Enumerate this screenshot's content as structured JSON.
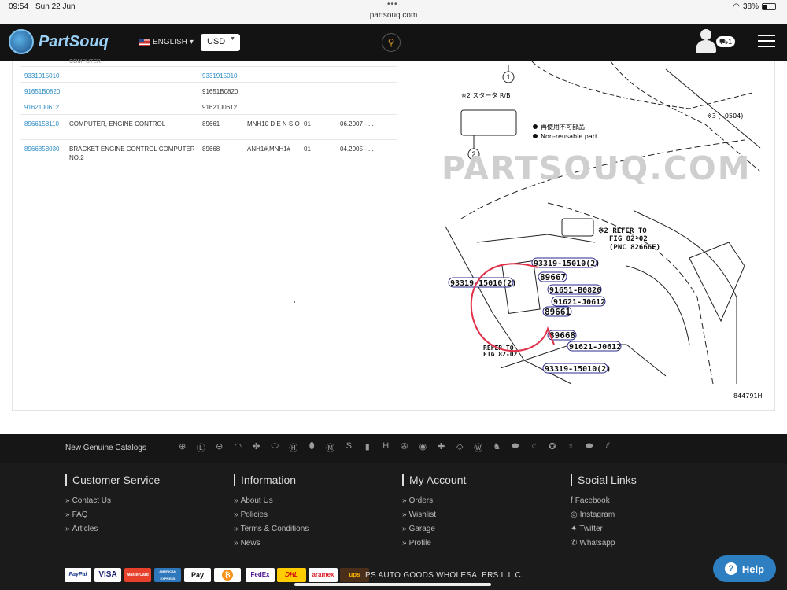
{
  "status_bar": {
    "time": "09:54",
    "date": "Sun 22 Jun",
    "url": "partsouq.com",
    "battery": "38%",
    "battery_level": 0.38
  },
  "header": {
    "brand": "PartSouq",
    "language": "ENGLISH",
    "currency": "USD",
    "cart_count": "1"
  },
  "table": {
    "clipped_text": "COMPUTER",
    "rows": [
      {
        "number": "9331915010",
        "name": "",
        "code": "9331915010",
        "model": "",
        "qty": "",
        "date": ""
      },
      {
        "number": "91651B0820",
        "name": "",
        "code": "91651B0820",
        "model": "",
        "qty": "",
        "date": ""
      },
      {
        "number": "91621J0612",
        "name": "",
        "code": "91621J0612",
        "model": "",
        "qty": "",
        "date": ""
      },
      {
        "number": "8966158110",
        "name": "COMPUTER, ENGINE CONTROL",
        "code": "89661",
        "model": "MNH10 D E N S O",
        "qty": "01",
        "date": "06.2007 - ..."
      },
      {
        "number": "8966858030",
        "name": "BRACKET ENGINE CONTROL COMPUTER NO.2",
        "code": "89668",
        "model": "ANH1#,MNH1#",
        "qty": "01",
        "date": "04.2005 - ..."
      }
    ]
  },
  "diagram": {
    "watermark": "PARTSOUQ.COM",
    "note_star2": "※2 スタータ R/B",
    "note_star3": "※3 (    -0504)",
    "legend_jp": "再使用不可部品",
    "legend_en": "Non-reusable part",
    "callout_1": "1",
    "callout_2": "2",
    "refer_1": "※2 REFER TO",
    "refer_2": "FIG 82-02",
    "refer_3": "(PNC 82666F)",
    "refer_4": "REFER TO",
    "refer_5": "FIG 82-02",
    "labels": [
      "93319-15010(2)",
      "89667",
      "93319-15010(2)",
      "91651-B0820",
      "91621-J0612",
      "89661",
      "89668",
      "91621-J0612",
      "93319-15010(2)"
    ],
    "ref_code": "844791H"
  },
  "brands": {
    "label": "New Genuine Catalogs",
    "logos": [
      "toyota-logo",
      "lexus-logo",
      "nissan-logo",
      "infiniti-logo",
      "mitsubishi-logo",
      "subaru-logo",
      "hyundai-logo",
      "kia-logo",
      "mazda-logo",
      "suzuki-logo",
      "gmc-logo",
      "honda-logo",
      "mercedes-logo",
      "bmw-logo",
      "chevrolet-logo",
      "renault-logo",
      "volkswagen-logo",
      "peugeot-logo",
      "ford-logo",
      "volvo-logo",
      "chrysler-logo",
      "citroen-logo",
      "dodge-logo",
      "isuzu-logo"
    ]
  },
  "footer": {
    "customer_service": {
      "title": "Customer Service",
      "links": [
        "Contact Us",
        "FAQ",
        "Articles"
      ]
    },
    "information": {
      "title": "Information",
      "links": [
        "About Us",
        "Policies",
        "Terms & Conditions",
        "News"
      ]
    },
    "my_account": {
      "title": "My Account",
      "links": [
        "Orders",
        "Wishlist",
        "Garage",
        "Profile"
      ]
    },
    "social": {
      "title": "Social Links",
      "links": [
        "Facebook",
        "Instagram",
        "Twitter",
        "Whatsapp"
      ]
    },
    "payments": [
      "PayPal",
      "VISA",
      "MasterCard",
      "AMERICAN EXPRESS",
      "Pay",
      "₿"
    ],
    "shipping": [
      "FedEx",
      "DHL",
      "aramex",
      "ups"
    ],
    "company": "PS AUTO GOODS WHOLESALERS L.L.C."
  },
  "help_button": "Help",
  "colors": {
    "link": "#2b8cc4",
    "header_bg": "#131313",
    "footer_bg": "#1b1b1b",
    "help": "#2d7fc2",
    "annotation": "#e0304a",
    "diagram_label": "#2a2a8c"
  }
}
